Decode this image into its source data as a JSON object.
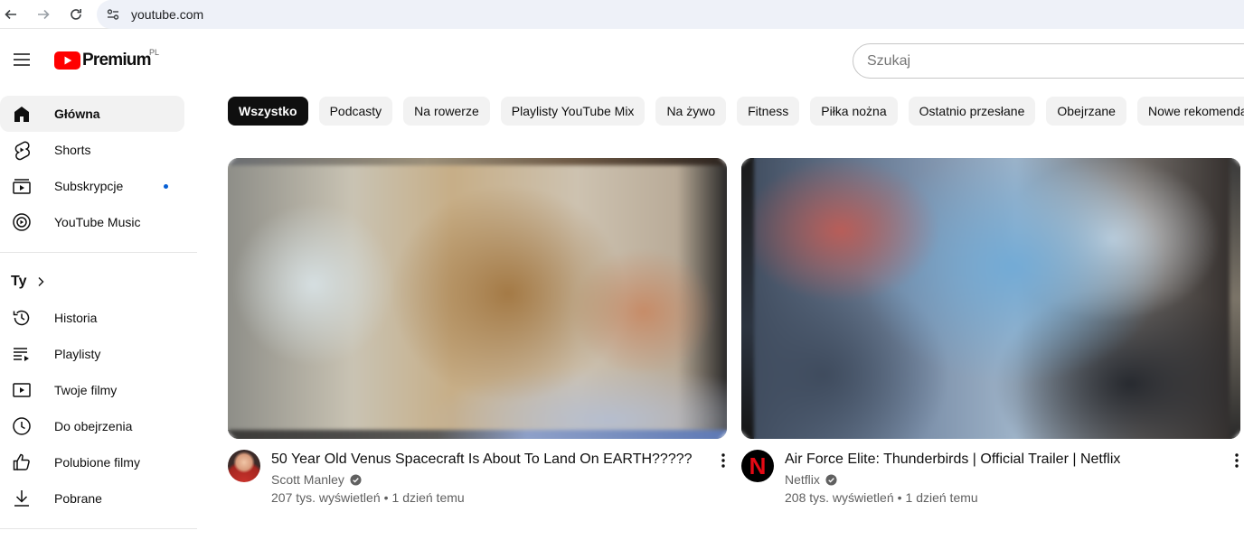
{
  "browser": {
    "url": "youtube.com"
  },
  "masthead": {
    "logo_text": "Premium",
    "country_code": "PL",
    "search_placeholder": "Szukaj"
  },
  "sidebar": {
    "main_items": [
      {
        "label": "Główna",
        "icon": "home-icon",
        "active": true
      },
      {
        "label": "Shorts",
        "icon": "shorts-icon"
      },
      {
        "label": "Subskrypcje",
        "icon": "subscriptions-icon",
        "new_dot": true
      },
      {
        "label": "YouTube Music",
        "icon": "youtube-music-icon"
      }
    ],
    "you_section": {
      "header": "Ty",
      "items": [
        {
          "label": "Historia",
          "icon": "history-icon"
        },
        {
          "label": "Playlisty",
          "icon": "playlists-icon"
        },
        {
          "label": "Twoje filmy",
          "icon": "your-videos-icon"
        },
        {
          "label": "Do obejrzenia",
          "icon": "watch-later-icon"
        },
        {
          "label": "Polubione filmy",
          "icon": "liked-videos-icon"
        },
        {
          "label": "Pobrane",
          "icon": "downloads-icon"
        }
      ]
    }
  },
  "chips": [
    {
      "label": "Wszystko",
      "selected": true
    },
    {
      "label": "Podcasty"
    },
    {
      "label": "Na rowerze"
    },
    {
      "label": "Playlisty YouTube Mix"
    },
    {
      "label": "Na żywo"
    },
    {
      "label": "Fitness"
    },
    {
      "label": "Piłka nożna"
    },
    {
      "label": "Ostatnio przesłane"
    },
    {
      "label": "Obejrzane"
    },
    {
      "label": "Nowe rekomendacje"
    }
  ],
  "videos": [
    {
      "title": "50 Year Old Venus Spacecraft Is About To Land On EARTH?????",
      "channel": "Scott Manley",
      "verified": true,
      "views": "207 tys. wyświetleń",
      "separator": "•",
      "age": "1 dzień temu"
    },
    {
      "title": "Air Force Elite: Thunderbirds | Official Trailer | Netflix",
      "channel": "Netflix",
      "channel_logo_letter": "N",
      "verified": true,
      "views": "208 tys. wyświetleń",
      "separator": "•",
      "age": "1 dzień temu"
    }
  ],
  "colors": {
    "accent_red": "#ff0000",
    "selected_chip_bg": "#0f0f0f",
    "chip_bg": "#f2f2f2",
    "new_dot": "#065fd4",
    "secondary_text": "#606060",
    "netflix_red": "#e50914"
  }
}
